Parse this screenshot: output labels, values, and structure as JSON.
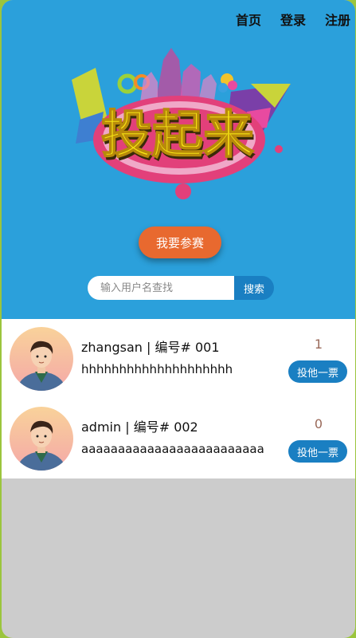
{
  "nav": {
    "home": "首页",
    "login": "登录",
    "register": "注册"
  },
  "banner": {
    "logo_text": "投起来"
  },
  "join_button": "我要参赛",
  "search": {
    "placeholder": "输入用户名查找",
    "button": "搜索"
  },
  "contestants": [
    {
      "username": "zhangsan",
      "number_label": "编号#",
      "number": "001",
      "title": "zhangsan | 编号# 001",
      "description": "hhhhhhhhhhhhhhhhhhhh",
      "votes": "1",
      "vote_button": "投他一票"
    },
    {
      "username": "admin",
      "number_label": "编号#",
      "number": "002",
      "title": "admin | 编号# 002",
      "description": "aaaaaaaaaaaaaaaaaaaaaaaaa",
      "votes": "0",
      "vote_button": "投他一票"
    }
  ],
  "colors": {
    "hero_bg": "#2ba0db",
    "join_button": "#e8692f",
    "primary_button": "#1a7fc2",
    "page_bg": "#cccccc",
    "outer_border": "#9bc53d"
  }
}
